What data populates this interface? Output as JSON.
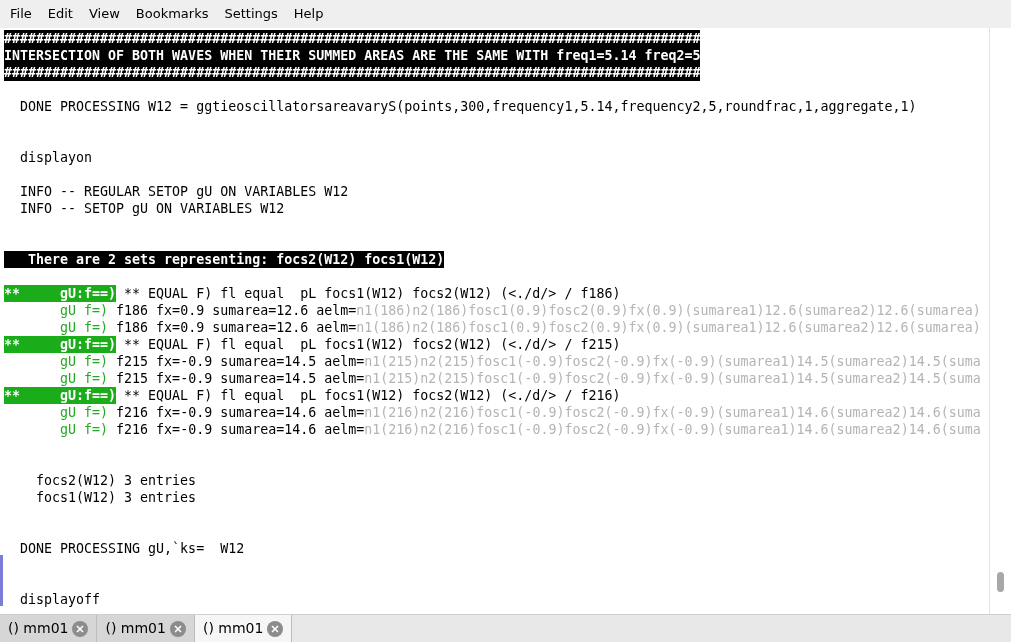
{
  "menu": [
    "File",
    "Edit",
    "View",
    "Bookmarks",
    "Settings",
    "Help"
  ],
  "lines": [
    {
      "kind": "text",
      "segments": [
        {
          "kind": "banner",
          "text": "#######################################################################################"
        }
      ]
    },
    {
      "kind": "text",
      "segments": [
        {
          "kind": "banner",
          "text": "INTERSECTION OF BOTH WAVES WHEN THEIR SUMMED AREAS ARE THE SAME WITH freq1=5.14 freq2=5"
        }
      ]
    },
    {
      "kind": "text",
      "segments": [
        {
          "kind": "banner",
          "text": "#######################################################################################"
        }
      ]
    },
    {
      "kind": "blank"
    },
    {
      "kind": "text",
      "segments": [
        {
          "kind": "plain",
          "text": "  DONE PROCESSING W12 = ggtieoscillatorsareavaryS(points,300,frequency1,5.14,frequency2,5,roundfrac,1,aggregate,1)"
        }
      ]
    },
    {
      "kind": "blank"
    },
    {
      "kind": "blank"
    },
    {
      "kind": "text",
      "segments": [
        {
          "kind": "plain",
          "text": "  displayon"
        }
      ]
    },
    {
      "kind": "blank"
    },
    {
      "kind": "text",
      "segments": [
        {
          "kind": "plain",
          "text": "  INFO -- REGULAR SETOP gU ON VARIABLES W12"
        }
      ]
    },
    {
      "kind": "text",
      "segments": [
        {
          "kind": "plain",
          "text": "  INFO -- SETOP gU ON VARIABLES W12"
        }
      ]
    },
    {
      "kind": "blank"
    },
    {
      "kind": "blank"
    },
    {
      "kind": "text",
      "segments": [
        {
          "kind": "banner",
          "text": "   There are 2 sets representing: focs2(W12) focs1(W12)"
        }
      ]
    },
    {
      "kind": "blank"
    },
    {
      "kind": "text",
      "segments": [
        {
          "kind": "badge",
          "text": "**     gU:f==)"
        },
        {
          "kind": "plain",
          "text": " ** EQUAL F) fl equal  pL focs1(W12) focs2(W12) (<./d/> / f186)"
        }
      ]
    },
    {
      "kind": "text",
      "segments": [
        {
          "kind": "green",
          "text": "       gU f=)"
        },
        {
          "kind": "plain",
          "text": " f186 fx=0.9 sumarea=12.6 aelm="
        },
        {
          "kind": "dim",
          "text": "n1(186)n2(186)fosc1(0.9)fosc2(0.9)fx(0.9)(sumarea1)12.6(sumarea2)12.6(sumarea)"
        }
      ]
    },
    {
      "kind": "text",
      "segments": [
        {
          "kind": "green",
          "text": "       gU f=)"
        },
        {
          "kind": "plain",
          "text": " f186 fx=0.9 sumarea=12.6 aelm="
        },
        {
          "kind": "dim",
          "text": "n1(186)n2(186)fosc1(0.9)fosc2(0.9)fx(0.9)(sumarea1)12.6(sumarea2)12.6(sumarea)"
        }
      ]
    },
    {
      "kind": "text",
      "segments": [
        {
          "kind": "badge",
          "text": "**     gU:f==)"
        },
        {
          "kind": "plain",
          "text": " ** EQUAL F) fl equal  pL focs1(W12) focs2(W12) (<./d/> / f215)"
        }
      ]
    },
    {
      "kind": "text",
      "segments": [
        {
          "kind": "green",
          "text": "       gU f=)"
        },
        {
          "kind": "plain",
          "text": " f215 fx=-0.9 sumarea=14.5 aelm="
        },
        {
          "kind": "dim",
          "text": "n1(215)n2(215)fosc1(-0.9)fosc2(-0.9)fx(-0.9)(sumarea1)14.5(sumarea2)14.5(suma"
        }
      ]
    },
    {
      "kind": "text",
      "segments": [
        {
          "kind": "green",
          "text": "       gU f=)"
        },
        {
          "kind": "plain",
          "text": " f215 fx=-0.9 sumarea=14.5 aelm="
        },
        {
          "kind": "dim",
          "text": "n1(215)n2(215)fosc1(-0.9)fosc2(-0.9)fx(-0.9)(sumarea1)14.5(sumarea2)14.5(suma"
        }
      ]
    },
    {
      "kind": "text",
      "segments": [
        {
          "kind": "badge",
          "text": "**     gU:f==)"
        },
        {
          "kind": "plain",
          "text": " ** EQUAL F) fl equal  pL focs1(W12) focs2(W12) (<./d/> / f216)"
        }
      ]
    },
    {
      "kind": "text",
      "segments": [
        {
          "kind": "green",
          "text": "       gU f=)"
        },
        {
          "kind": "plain",
          "text": " f216 fx=-0.9 sumarea=14.6 aelm="
        },
        {
          "kind": "dim",
          "text": "n1(216)n2(216)fosc1(-0.9)fosc2(-0.9)fx(-0.9)(sumarea1)14.6(sumarea2)14.6(suma"
        }
      ]
    },
    {
      "kind": "text",
      "segments": [
        {
          "kind": "green",
          "text": "       gU f=)"
        },
        {
          "kind": "plain",
          "text": " f216 fx=-0.9 sumarea=14.6 aelm="
        },
        {
          "kind": "dim",
          "text": "n1(216)n2(216)fosc1(-0.9)fosc2(-0.9)fx(-0.9)(sumarea1)14.6(sumarea2)14.6(suma"
        }
      ]
    },
    {
      "kind": "blank"
    },
    {
      "kind": "blank"
    },
    {
      "kind": "text",
      "segments": [
        {
          "kind": "plain",
          "text": "    focs2(W12) 3 entries"
        }
      ]
    },
    {
      "kind": "text",
      "segments": [
        {
          "kind": "plain",
          "text": "    focs1(W12) 3 entries"
        }
      ]
    },
    {
      "kind": "blank"
    },
    {
      "kind": "blank"
    },
    {
      "kind": "text",
      "segments": [
        {
          "kind": "plain",
          "text": "  DONE PROCESSING gU,`ks=  W12"
        }
      ]
    },
    {
      "kind": "blank"
    },
    {
      "kind": "blank"
    },
    {
      "kind": "text",
      "segments": [
        {
          "kind": "plain",
          "text": "  displayoff"
        }
      ]
    }
  ],
  "tabs": [
    {
      "label": "() mm01",
      "selected": false
    },
    {
      "label": "() mm01",
      "selected": false
    },
    {
      "label": "() mm01",
      "selected": true
    }
  ]
}
